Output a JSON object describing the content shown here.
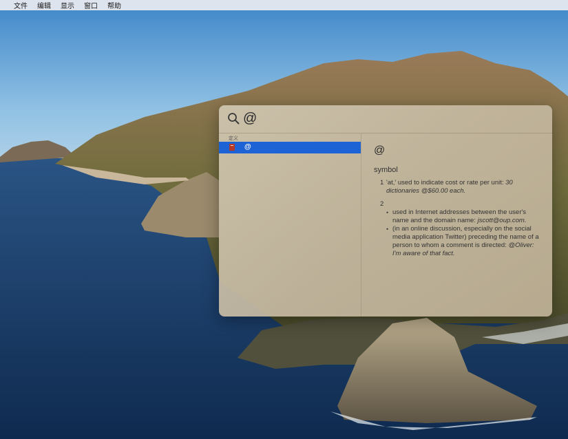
{
  "menubar": {
    "apple_glyph": "",
    "items": [
      "文件",
      "编辑",
      "显示",
      "窗口",
      "帮助"
    ]
  },
  "spotlight": {
    "query": "@",
    "results": {
      "section": "定义",
      "selected_item": "@"
    },
    "preview": {
      "headword": "@",
      "part_of_speech": "symbol",
      "def1_number": "1",
      "def1_text": "'at,' used to indicate cost or rate per unit:",
      "def1_example": "30 dictionaries @$60.00 each.",
      "def2_number": "2",
      "def2a_text": "used in Internet addresses between the user's name and the domain name:",
      "def2a_example": "jscott@oup.com.",
      "def2b_text": "(in an online discussion, especially on the social media application Twitter) preceding the name of a person to whom a comment is directed:",
      "def2b_example": "@Oliver: I'm aware of that fact."
    }
  },
  "colors": {
    "selection": "#1e63d5",
    "sky": "#5fa2d6",
    "sea": "#1d3f6b"
  },
  "icons": {
    "search": "magnifier-icon",
    "dictionary": "dictionary-app-icon"
  }
}
